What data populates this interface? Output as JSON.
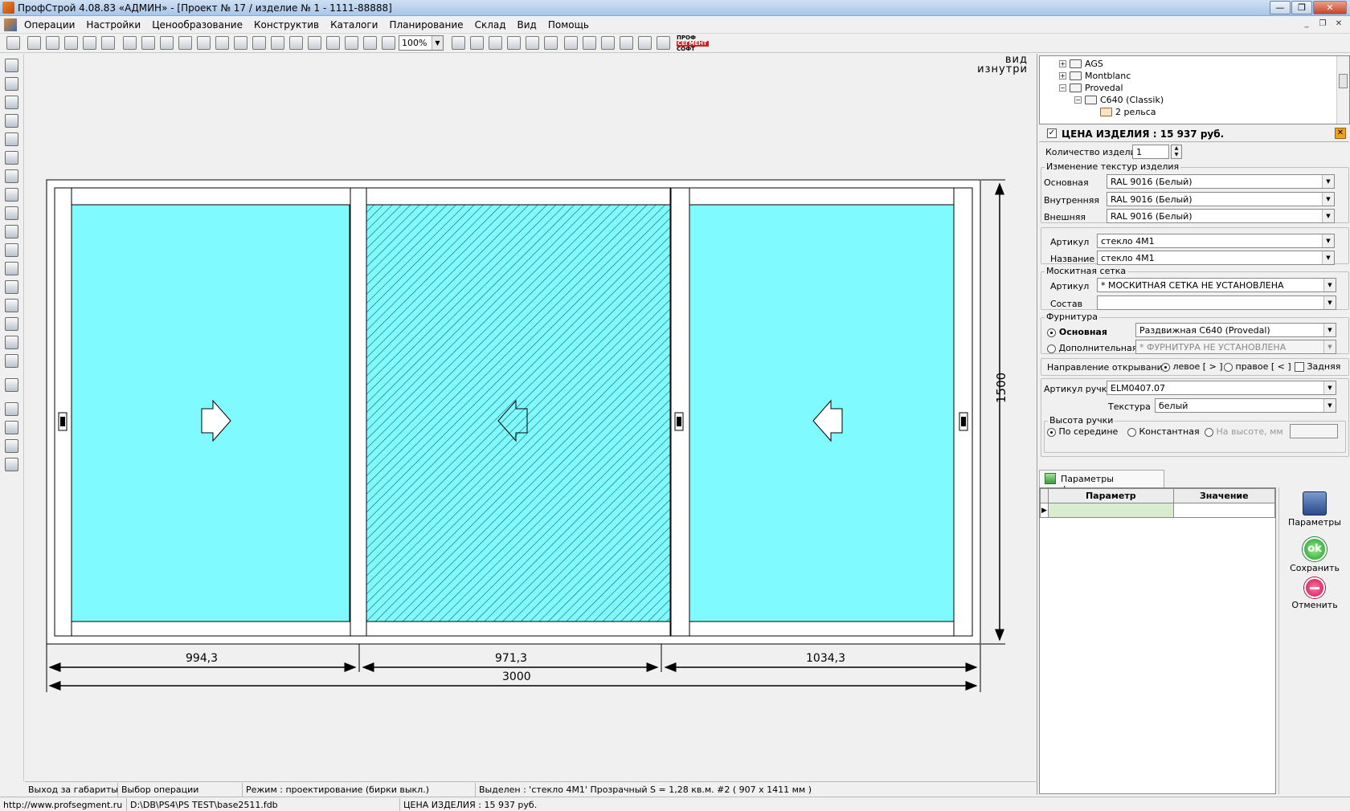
{
  "window": {
    "title": "ПрофСтрой 4.08.83 «АДМИН» - [Проект № 17 / изделие № 1  -  1111-88888]"
  },
  "menu": [
    "Операции",
    "Настройки",
    "Ценообразование",
    "Конструктив",
    "Каталоги",
    "Планирование",
    "Склад",
    "Вид",
    "Помощь"
  ],
  "toolbar": {
    "zoom": "100%",
    "logo_line1": "ПРОФ",
    "logo_line2": "СЕГМЕНТ",
    "logo_line3": "СОФТ"
  },
  "canvas": {
    "view_label_1": "вид",
    "view_label_2": "изнутри",
    "dim_height": "1500",
    "dim_widths": [
      "994,3",
      "971,3",
      "1034,3"
    ],
    "dim_total": "3000"
  },
  "tree": {
    "items": [
      {
        "label": "AGS"
      },
      {
        "label": "Montblanc"
      },
      {
        "label": "Provedal"
      },
      {
        "label": "C640 (Classik)"
      },
      {
        "label": "2 рельса"
      }
    ]
  },
  "price": {
    "label": "ЦЕНА ИЗДЕЛИЯ :",
    "value": "15 937",
    "currency": "руб."
  },
  "quantity": {
    "label": "Количество изделий",
    "value": "1"
  },
  "textures": {
    "group_title": "Изменение текстур изделия",
    "main_label": "Основная",
    "main_value": "RAL 9016 (Белый)",
    "inner_label": "Внутренняя",
    "inner_value": "RAL 9016 (Белый)",
    "outer_label": "Внешняя",
    "outer_value": "RAL 9016 (Белый)"
  },
  "glass": {
    "article_label": "Артикул",
    "article_value": "стекло 4М1",
    "name_label": "Название",
    "name_value": "стекло 4М1"
  },
  "mosquito": {
    "group_title": "Москитная сетка",
    "article_label": "Артикул",
    "article_value": "* МОСКИТНАЯ СЕТКА НЕ УСТАНОВЛЕНА",
    "composition_label": "Состав",
    "composition_value": ""
  },
  "hardware": {
    "group_title": "Фурнитура",
    "main_label": "Основная",
    "main_value": "Раздвижная С640 (Provedal)",
    "extra_label": "Дополнительная",
    "extra_value": "* ФУРНИТУРА НЕ УСТАНОВЛЕНА"
  },
  "opening": {
    "label": "Направление открывания",
    "left": "левое [ > ]",
    "right": "правое [ < ]",
    "rear": "Задняя"
  },
  "handle": {
    "article_label": "Артикул ручки",
    "article_value": "ELM0407.07",
    "texture_label": "Текстура",
    "texture_value": "белый"
  },
  "handle_height": {
    "group_title": "Высота ручки",
    "center": "По середине",
    "constant": "Константная",
    "at_height": "На высоте, мм"
  },
  "params_tab": {
    "label": "Параметры фурнитуры"
  },
  "params_table": {
    "col_param": "Параметр",
    "col_value": "Значение"
  },
  "actions": {
    "params": "Параметры",
    "save": "Сохранить",
    "cancel": "Отменить",
    "ok_icon_text": "ok"
  },
  "status1": {
    "s1": "Выход за габариты",
    "s2": "Выбор операции",
    "s3": "Режим : проектирование  (бирки выкл.)",
    "s4": "Выделен : 'стекло 4М1' Прозрачный    S = 1,28 кв.м.  #2 ( 907 x 1411 мм )"
  },
  "status2": {
    "url": "http://www.profsegment.ru",
    "path": "D:\\DB\\PS4\\PS TEST\\base2511.fdb",
    "price": "ЦЕНА ИЗДЕЛИЯ :  15 937  руб."
  },
  "colors": {
    "glass": "#7ffbff",
    "frame": "#ffffff",
    "accent_orange": "#f0a020"
  }
}
